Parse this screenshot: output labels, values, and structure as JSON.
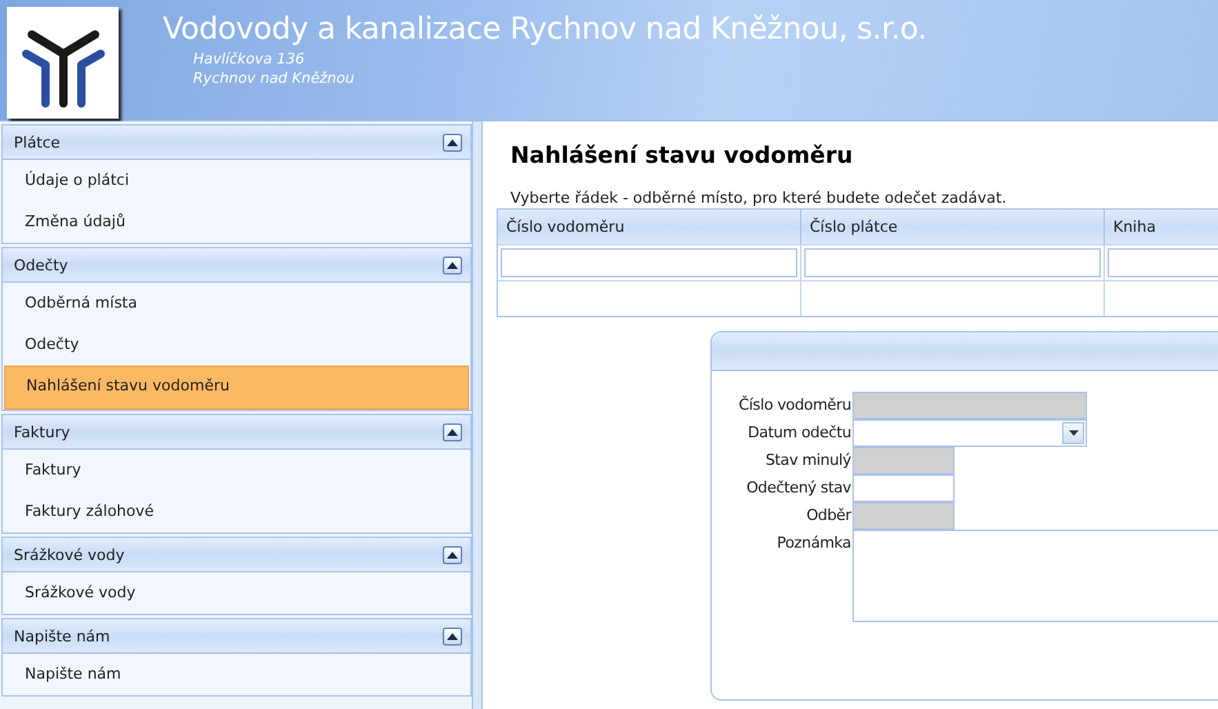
{
  "header": {
    "title": "Vodovody a kanalizace Rychnov nad Kněžnou, s.r.o.",
    "address": [
      "Havlíčkova 136",
      "Rychnov nad Kněžnou"
    ]
  },
  "sidebar": {
    "sections": [
      {
        "title": "Plátce",
        "expanded": true,
        "items": [
          {
            "label": "Údaje o plátci",
            "selected": false
          },
          {
            "label": "Změna údajů",
            "selected": false
          }
        ]
      },
      {
        "title": "Odečty",
        "expanded": true,
        "items": [
          {
            "label": "Odběrná místa",
            "selected": false
          },
          {
            "label": "Odečty",
            "selected": false
          },
          {
            "label": "Nahlášení stavu vodoměru",
            "selected": true
          }
        ]
      },
      {
        "title": "Faktury",
        "expanded": true,
        "items": [
          {
            "label": "Faktury",
            "selected": false
          },
          {
            "label": "Faktury zálohové",
            "selected": false
          }
        ]
      },
      {
        "title": "Srážkové vody",
        "expanded": true,
        "items": [
          {
            "label": "Srážkové vody",
            "selected": false
          }
        ]
      },
      {
        "title": "Napište nám",
        "expanded": true,
        "items": [
          {
            "label": "Napište nám",
            "selected": false
          }
        ]
      }
    ]
  },
  "page": {
    "title": "Nahlášení stavu vodoměru",
    "instruction": "Vyberte řádek - odběrné místo, pro které budete odečet zadávat."
  },
  "table": {
    "columns": [
      "Číslo vodoměru",
      "Číslo plátce",
      "Kniha"
    ],
    "rows": [
      {
        "kind": "edit"
      },
      {
        "kind": "plain"
      }
    ]
  },
  "form": {
    "fields": [
      {
        "label": "Číslo vodoměru",
        "kind": "text",
        "disabled": true
      },
      {
        "label": "Datum odečtu",
        "kind": "date",
        "disabled": false
      },
      {
        "label": "Stav minulý",
        "kind": "number",
        "disabled": true
      },
      {
        "label": "Odečtený stav",
        "kind": "number",
        "disabled": false
      },
      {
        "label": "Odběr",
        "kind": "number",
        "disabled": true
      },
      {
        "label": "Poznámka",
        "kind": "textarea",
        "disabled": false
      }
    ]
  }
}
